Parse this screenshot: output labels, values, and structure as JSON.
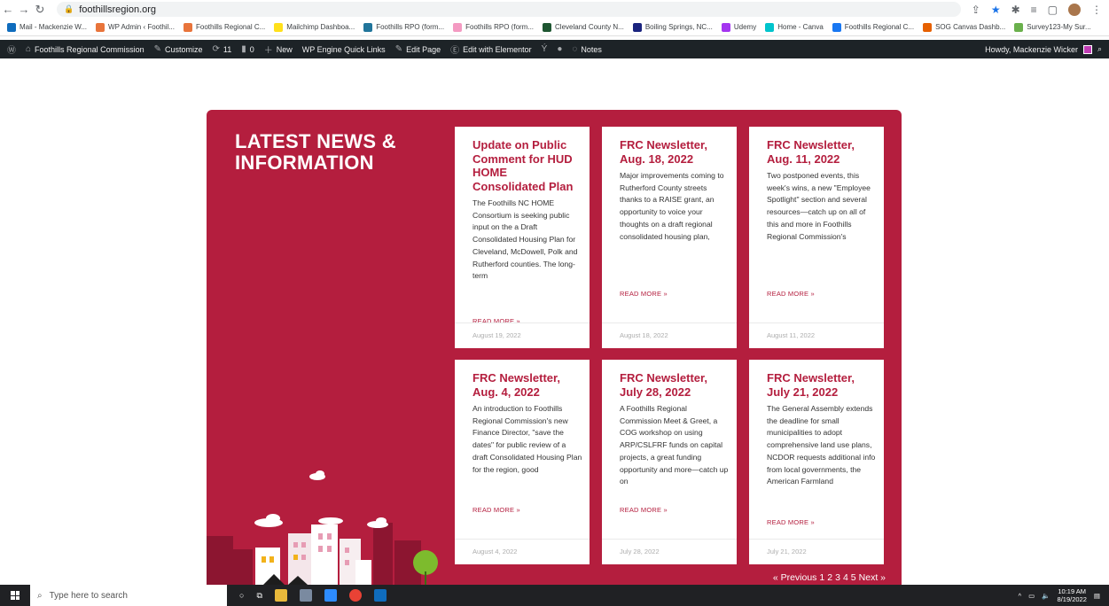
{
  "browser": {
    "url": "foothillsregion.org",
    "bookmarks": [
      {
        "label": "Mail - Mackenzie W...",
        "color": "#0f6cbd"
      },
      {
        "label": "WP Admin ‹ Foothil...",
        "color": "#e8743b"
      },
      {
        "label": "Foothills Regional C...",
        "color": "#e8743b"
      },
      {
        "label": "Mailchimp Dashboa...",
        "color": "#ffe01b"
      },
      {
        "label": "Foothills RPO (form...",
        "color": "#21759b"
      },
      {
        "label": "Foothills RPO (form...",
        "color": "#f49ac2"
      },
      {
        "label": "Cleveland County N...",
        "color": "#1e5631"
      },
      {
        "label": "Boiling Springs, NC...",
        "color": "#1a237e"
      },
      {
        "label": "Udemy",
        "color": "#a435f0"
      },
      {
        "label": "Home - Canva",
        "color": "#00c4cc"
      },
      {
        "label": "Foothills Regional C...",
        "color": "#1877f2"
      },
      {
        "label": "SOG Canvas Dashb...",
        "color": "#e66000"
      },
      {
        "label": "Survey123-My Sur...",
        "color": "#6ab04c"
      }
    ]
  },
  "wp_admin": {
    "site_name": "Foothills Regional Commission",
    "customize": "Customize",
    "updates": "11",
    "comments": "0",
    "new": "New",
    "wp_engine": "WP Engine Quick Links",
    "edit_page": "Edit Page",
    "elementor": "Edit with Elementor",
    "notes": "Notes",
    "howdy": "Howdy, Mackenzie Wicker"
  },
  "news": {
    "heading": "LATEST NEWS & INFORMATION",
    "read_more": "READ MORE »",
    "cards": [
      {
        "title": "Update on Public Comment for HUD HOME Consolidated Plan",
        "excerpt": "The Foothills NC HOME Consortium is seeking public input on the a Draft Consolidated Housing Plan for Cleveland, McDowell, Polk and Rutherford counties. The long-term",
        "date": "August 19, 2022"
      },
      {
        "title": "FRC Newsletter, Aug. 18, 2022",
        "excerpt": "Major improvements coming to Rutherford County streets thanks to a RAISE grant, an opportunity to voice your thoughts on a draft regional consolidated housing plan,",
        "date": "August 18, 2022"
      },
      {
        "title": "FRC Newsletter, Aug. 11, 2022",
        "excerpt": "Two postponed events, this week's wins, a new \"Employee Spotlight\" section and several resources—catch up on all of this and more in Foothills Regional Commission's",
        "date": "August 11, 2022"
      },
      {
        "title": "FRC Newsletter, Aug. 4, 2022",
        "excerpt": "An introduction to Foothills Regional Commission's new Finance Director, \"save the dates\" for public review of a draft Consolidated Housing Plan for the region, good",
        "date": "August 4, 2022"
      },
      {
        "title": "FRC Newsletter, July 28, 2022",
        "excerpt": "A Foothills Regional Commission Meet & Greet, a COG workshop on using ARP/CSLFRF funds on capital projects, a great funding opportunity and more—catch up on",
        "date": "July 28, 2022"
      },
      {
        "title": "FRC Newsletter, July 21, 2022",
        "excerpt": "The General Assembly extends the deadline for small municipalities to adopt comprehensive land use plans, NCDOR requests additional info from local governments, the American Farmland",
        "date": "July 21, 2022"
      }
    ],
    "pagination": {
      "previous": "« Previous",
      "pages": [
        "1",
        "2",
        "3",
        "4",
        "5"
      ],
      "next": "Next »"
    }
  },
  "taskbar": {
    "search_placeholder": "Type here to search",
    "time": "10:19 AM",
    "date": "8/19/2022"
  }
}
